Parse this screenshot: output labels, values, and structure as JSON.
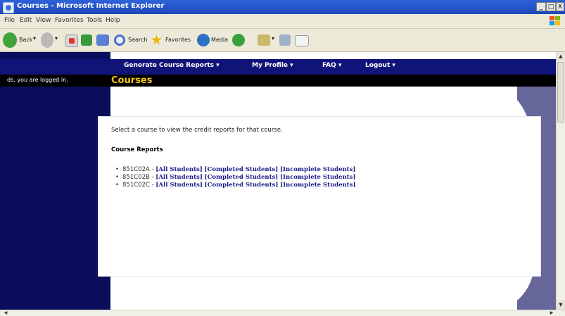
{
  "window": {
    "title": "Courses - Microsoft Internet Explorer",
    "minimize": "_",
    "maximize": "□",
    "close": "X"
  },
  "menu": [
    "File",
    "Edit",
    "View",
    "Favorites",
    "Tools",
    "Help"
  ],
  "toolbar": {
    "back_label": "Back",
    "search_label": "Search",
    "favorites_label": "Favorites",
    "media_label": "Media"
  },
  "nav": {
    "items": [
      "Generate Course Reports ▾",
      "My Profile ▾",
      "FAQ ▾",
      "Logout ▾"
    ]
  },
  "sidebar": {
    "status": "ds, you are logged in."
  },
  "page": {
    "heading": "Courses",
    "intro": "Select a course to view the credit reports for that course.",
    "section_title": "Course Reports"
  },
  "courses": [
    {
      "code": "851C02A",
      "all": "[All Students]",
      "completed": "[Completed Students]",
      "incomplete": "[Incomplete Students]"
    },
    {
      "code": "851C02B",
      "all": "[All Students]",
      "completed": "[Completed Students]",
      "incomplete": "[Incomplete Students]"
    },
    {
      "code": "851C02C",
      "all": "[All Students]",
      "completed": "[Completed Students]",
      "incomplete": "[Incomplete Students]"
    }
  ],
  "colors": {
    "sidebar": "#0b0e5c",
    "navbar": "#101478",
    "heading": "#f3c316",
    "link": "#1a1a8a",
    "right_band": "#66669a"
  }
}
